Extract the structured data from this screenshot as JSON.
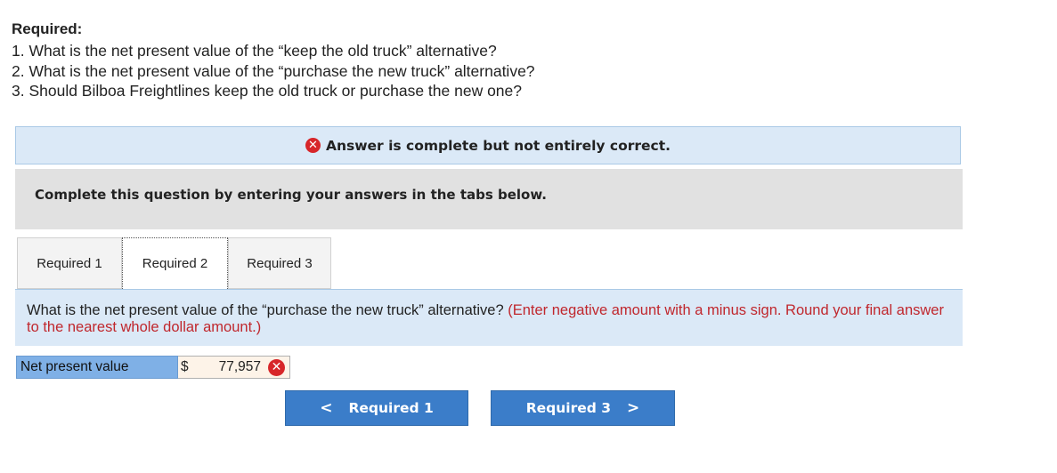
{
  "required": {
    "title": "Required:",
    "lines": [
      "1. What is the net present value of the “keep the old truck” alternative?",
      "2. What is the net present value of the “purchase the new truck” alternative?",
      "3. Should Bilboa Freightlines keep the old truck or purchase the new one?"
    ]
  },
  "status": {
    "icon": "x-icon",
    "message": "Answer is complete but not entirely correct."
  },
  "instructions": "Complete this question by entering your answers in the tabs below.",
  "tabs": [
    {
      "label": "Required 1"
    },
    {
      "label": "Required 2"
    },
    {
      "label": "Required 3"
    }
  ],
  "active_tab": "Required 2",
  "question": {
    "text": "What is the net present value of the “purchase the new truck” alternative?",
    "hint": "(Enter negative amount with a minus sign. Round your final answer to the nearest whole dollar amount.)"
  },
  "answer": {
    "label": "Net present value",
    "currency": "$",
    "value": "77,957",
    "result_icon": "x-icon"
  },
  "navigation": {
    "prev_label": "Required 1",
    "next_label": "Required 3",
    "prev_chevron": "<",
    "next_chevron": ">"
  },
  "colors": {
    "incorrect": "#d7262a",
    "button": "#3b7dc9",
    "hint": "#c0272d"
  }
}
